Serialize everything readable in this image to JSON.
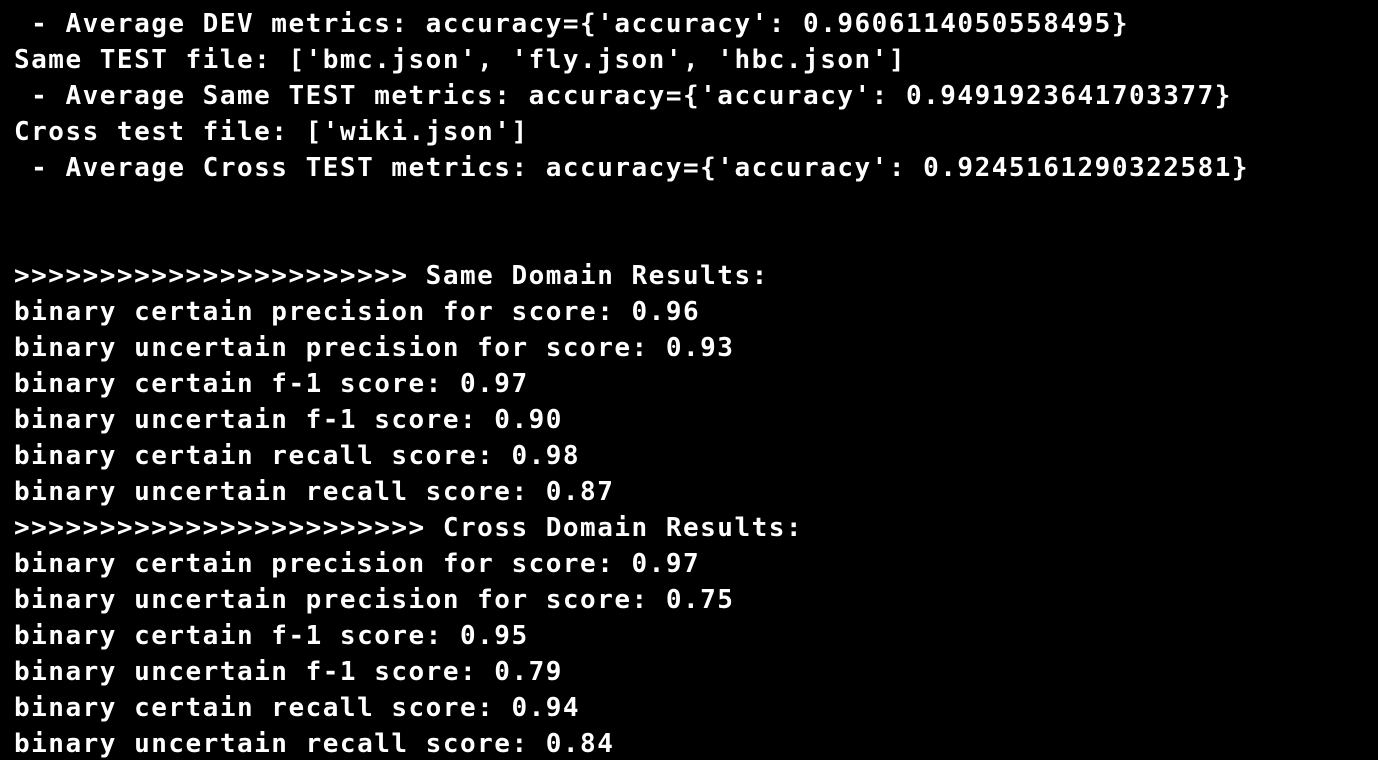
{
  "terminal": {
    "lines": [
      " - Average DEV metrics: accuracy={'accuracy': 0.9606114050558495}",
      "Same TEST file: ['bmc.json', 'fly.json', 'hbc.json']",
      " - Average Same TEST metrics: accuracy={'accuracy': 0.9491923641703377}",
      "Cross test file: ['wiki.json']",
      " - Average Cross TEST metrics: accuracy={'accuracy': 0.9245161290322581}",
      "",
      "",
      ">>>>>>>>>>>>>>>>>>>>>>> Same Domain Results:",
      "binary certain precision for score: 0.96",
      "binary uncertain precision for score: 0.93",
      "binary certain f-1 score: 0.97",
      "binary uncertain f-1 score: 0.90",
      "binary certain recall score: 0.98",
      "binary uncertain recall score: 0.87",
      ">>>>>>>>>>>>>>>>>>>>>>>> Cross Domain Results:",
      "binary certain precision for score: 0.97",
      "binary uncertain precision for score: 0.75",
      "binary certain f-1 score: 0.95",
      "binary uncertain f-1 score: 0.79",
      "binary certain recall score: 0.94",
      "binary uncertain recall score: 0.84"
    ],
    "colors": {
      "background": "#000000",
      "text": "#ffffff"
    }
  }
}
